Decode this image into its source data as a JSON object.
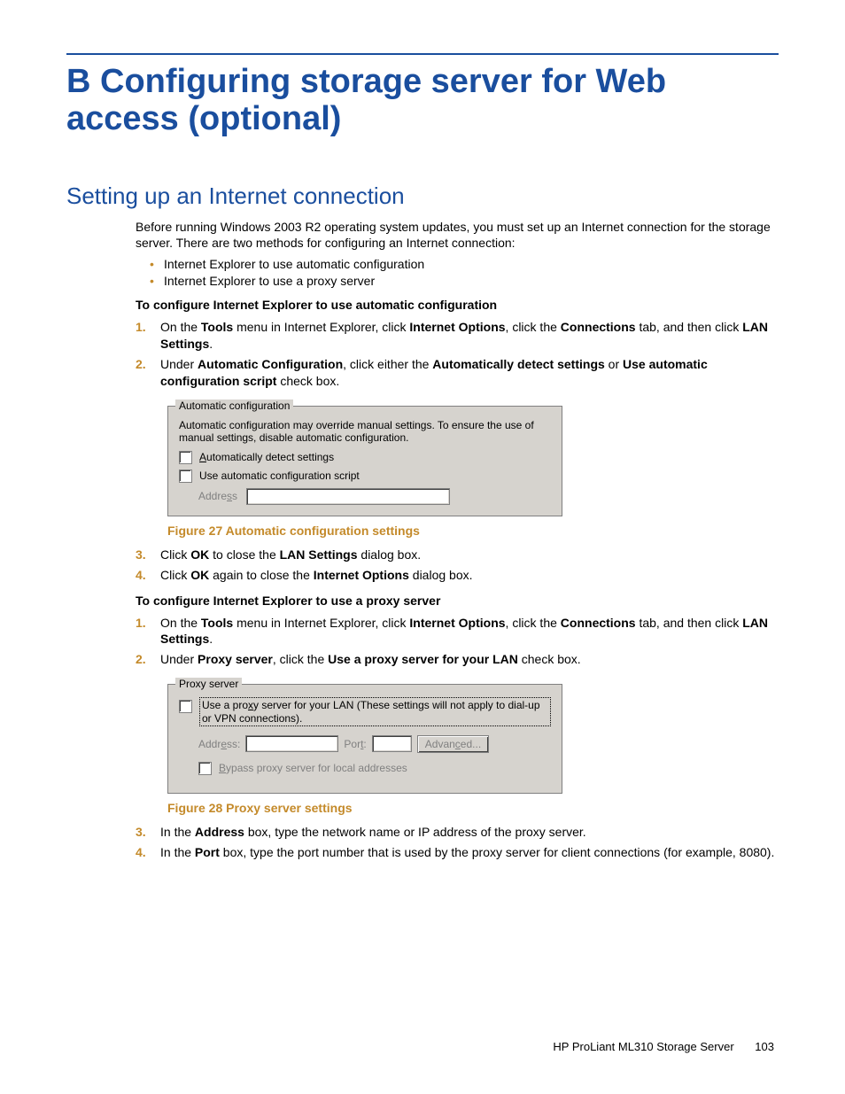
{
  "chapter_title": "B Configuring storage server for Web access (optional)",
  "section_title": "Setting up an Internet connection",
  "intro": "Before running Windows 2003 R2 operating system updates, you must set up an Internet connection for the storage server.  There are two methods for configuring an Internet connection:",
  "bullets": [
    "Internet Explorer to use automatic configuration",
    "Internet Explorer to use a proxy server"
  ],
  "subhead1": "To configure Internet Explorer to use automatic configuration",
  "steps1": [
    {
      "n": "1.",
      "parts": [
        "On the ",
        {
          "b": "Tools"
        },
        " menu in Internet Explorer, click ",
        {
          "b": "Internet Options"
        },
        ", click the ",
        {
          "b": "Connections"
        },
        " tab, and then click ",
        {
          "b": "LAN Settings"
        },
        "."
      ]
    },
    {
      "n": "2.",
      "parts": [
        "Under ",
        {
          "b": "Automatic Configuration"
        },
        ", click either the ",
        {
          "b": "Automatically detect settings"
        },
        " or ",
        {
          "b": "Use automatic configuration script"
        },
        " check box."
      ]
    }
  ],
  "fig27": {
    "legend": "Automatic configuration",
    "desc": "Automatic configuration may override manual settings.  To ensure the use of manual settings, disable automatic configuration.",
    "cb1": "Automatically detect settings",
    "cb2": "Use automatic configuration script",
    "addr_label": "Address"
  },
  "fig27_caption": "Figure 27 Automatic configuration settings",
  "steps1b": [
    {
      "n": "3.",
      "parts": [
        "Click ",
        {
          "b": "OK"
        },
        " to close the ",
        {
          "b": "LAN Settings"
        },
        " dialog box."
      ]
    },
    {
      "n": "4.",
      "parts": [
        "Click ",
        {
          "b": "OK"
        },
        " again to close the ",
        {
          "b": "Internet Options"
        },
        " dialog box."
      ]
    }
  ],
  "subhead2": "To configure Internet Explorer to use a proxy server",
  "steps2": [
    {
      "n": "1.",
      "parts": [
        "On the ",
        {
          "b": "Tools"
        },
        " menu in Internet Explorer, click ",
        {
          "b": "Internet Options"
        },
        ", click the ",
        {
          "b": "Connections"
        },
        " tab, and then click ",
        {
          "b": "LAN Settings"
        },
        "."
      ]
    },
    {
      "n": "2.",
      "parts": [
        "Under ",
        {
          "b": "Proxy server"
        },
        ", click the ",
        {
          "b": "Use a proxy server for your LAN"
        },
        " check box."
      ]
    }
  ],
  "fig28": {
    "legend": "Proxy server",
    "cb_main_pre": "Use a pro",
    "cb_main_u": "x",
    "cb_main_post": "y server for your LAN (These settings will not apply to dial-up or VPN connections).",
    "addr_pre": "Addr",
    "addr_u": "e",
    "addr_post": "ss:",
    "port_pre": "Por",
    "port_u": "t",
    "port_post": ":",
    "adv_pre": "Advan",
    "adv_u": "c",
    "adv_post": "ed...",
    "bypass_pre": "",
    "bypass_u": "B",
    "bypass_post": "ypass proxy server for local addresses"
  },
  "fig28_caption": "Figure 28 Proxy server settings",
  "steps2b": [
    {
      "n": "3.",
      "parts": [
        "In the ",
        {
          "b": "Address"
        },
        " box, type the network name or IP address of the proxy server."
      ]
    },
    {
      "n": "4.",
      "parts": [
        "In the ",
        {
          "b": "Port"
        },
        " box, type the port number that is used by the proxy server for client connections (for example, 8080)."
      ]
    }
  ],
  "footer_text": "HP ProLiant ML310 Storage Server",
  "page_number": "103"
}
